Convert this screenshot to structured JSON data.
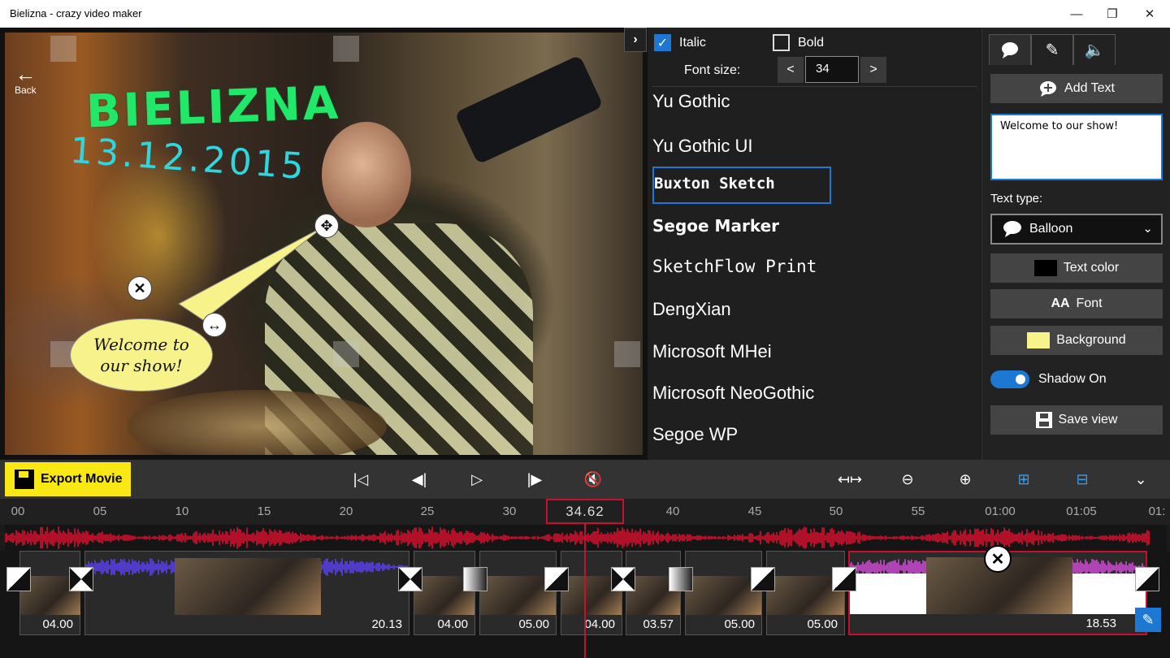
{
  "window": {
    "title": "Bielizna - crazy video maker",
    "minimize": "—",
    "restore": "❐",
    "close": "✕"
  },
  "preview": {
    "back_label": "Back",
    "hand_title": "BIELIZNA",
    "hand_date": "13.12.2015",
    "balloon_text": "Welcome to our show!"
  },
  "font_panel": {
    "italic_label": "Italic",
    "italic_checked": true,
    "bold_label": "Bold",
    "bold_checked": false,
    "font_size_label": "Font size:",
    "font_size_value": "34",
    "dec_label": "<",
    "inc_label": ">",
    "fonts": [
      "Yu Gothic",
      "Yu Gothic UI",
      "Buxton Sketch",
      "Segoe Marker",
      "SketchFlow Print",
      "DengXian",
      "Microsoft MHei",
      "Microsoft NeoGothic",
      "Segoe WP"
    ],
    "selected_font": "Buxton Sketch"
  },
  "right_panel": {
    "tabs": [
      "balloon-tab-icon",
      "pen-tab-icon",
      "speaker-tab-icon"
    ],
    "add_text_label": "Add Text",
    "text_value": "Welcome to our show!",
    "text_type_label": "Text type:",
    "text_type_value": "Balloon",
    "text_color_label": "Text color",
    "text_color": "#000000",
    "font_label": "Font",
    "background_label": "Background",
    "background_color": "#f7f28a",
    "shadow_label": "Shadow On",
    "shadow_on": true,
    "save_view_label": "Save view"
  },
  "toolbar": {
    "export_label": "Export Movie"
  },
  "ruler": {
    "ticks": [
      "00",
      "05",
      "10",
      "15",
      "20",
      "25",
      "30",
      "40",
      "45",
      "50",
      "55",
      "01:00",
      "01:05",
      "01:"
    ],
    "playhead_time": "34.62"
  },
  "clips": [
    "04.00",
    "20.13",
    "04.00",
    "05.00",
    "04.00",
    "03.57",
    "05.00",
    "05.00",
    "18.53"
  ],
  "colors": {
    "accent": "#1d78d4",
    "export": "#f9e814",
    "playhead": "#c8102e",
    "audio_wave": "#d8102e",
    "clip_wave": "#5a3ef0"
  }
}
